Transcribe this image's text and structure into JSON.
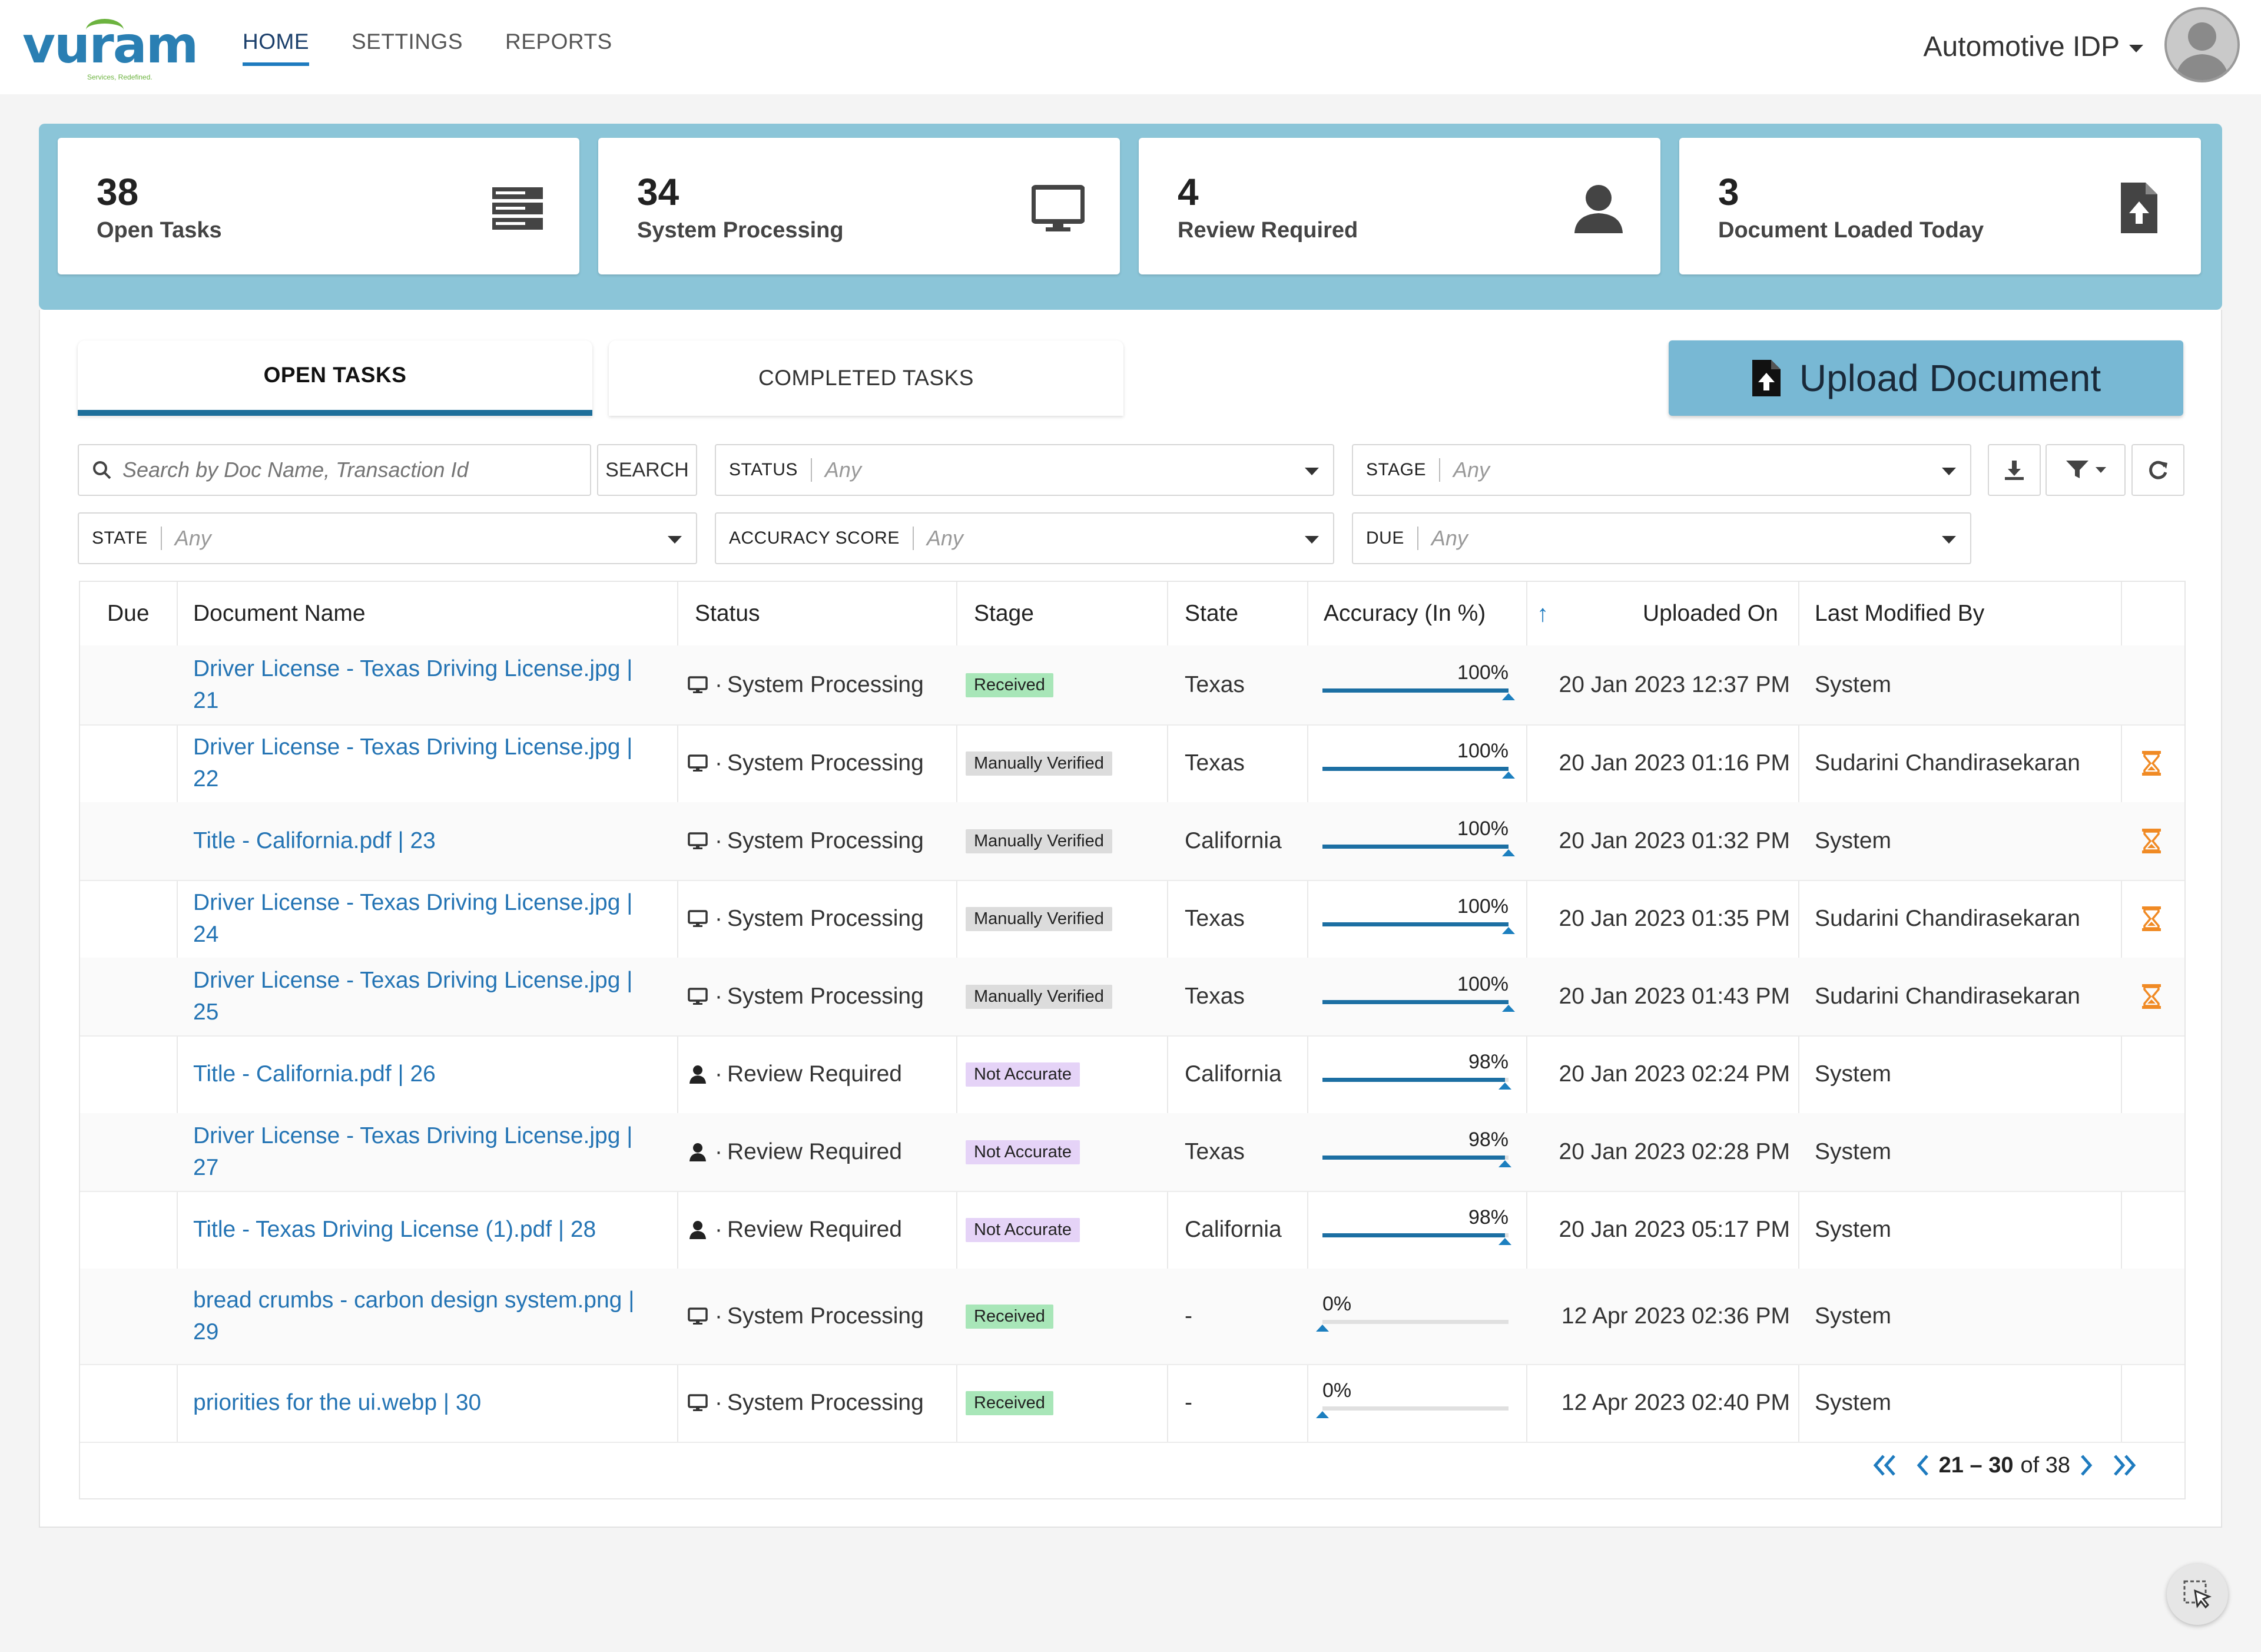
{
  "brand": {
    "logo_text": "vuram",
    "tagline": "Services, Redefined."
  },
  "nav": {
    "home": "HOME",
    "settings": "SETTINGS",
    "reports": "REPORTS"
  },
  "workspace": "Automotive IDP",
  "stats": [
    {
      "value": "38",
      "label": "Open Tasks",
      "icon": "server-icon"
    },
    {
      "value": "34",
      "label": "System Processing",
      "icon": "monitor-icon"
    },
    {
      "value": "4",
      "label": "Review Required",
      "icon": "user-icon"
    },
    {
      "value": "3",
      "label": "Document Loaded Today",
      "icon": "file-upload-icon"
    }
  ],
  "tabs": {
    "open": "OPEN TASKS",
    "completed": "COMPLETED TASKS"
  },
  "upload_label": "Upload Document",
  "search": {
    "placeholder": "Search by Doc Name, Transaction Id",
    "button": "SEARCH"
  },
  "filters": {
    "status": {
      "label": "STATUS",
      "value": "Any"
    },
    "stage": {
      "label": "STAGE",
      "value": "Any"
    },
    "state": {
      "label": "STATE",
      "value": "Any"
    },
    "accuracy": {
      "label": "ACCURACY SCORE",
      "value": "Any"
    },
    "due": {
      "label": "DUE",
      "value": "Any"
    }
  },
  "table": {
    "columns": {
      "due": "Due",
      "document_name": "Document Name",
      "status": "Status",
      "stage": "Stage",
      "state": "State",
      "accuracy": "Accuracy (In %)",
      "uploaded_on": "Uploaded On",
      "last_modified_by": "Last Modified By"
    },
    "rows": [
      {
        "document": "Driver License - Texas Driving License.jpg | 21",
        "status": "System Processing",
        "status_icon": "monitor-icon",
        "stage": "Received",
        "stage_color": "#a8e6b8",
        "state": "Texas",
        "accuracy": 100,
        "accuracy_label": "100%",
        "uploaded": "20 Jan 2023 12:37 PM",
        "modified_by": "System",
        "pending": false
      },
      {
        "document": "Driver License - Texas Driving License.jpg | 22",
        "status": "System Processing",
        "status_icon": "monitor-icon",
        "stage": "Manually Verified",
        "stage_color": "#dcdcdc",
        "state": "Texas",
        "accuracy": 100,
        "accuracy_label": "100%",
        "uploaded": "20 Jan 2023 01:16 PM",
        "modified_by": "Sudarini Chandirasekaran",
        "pending": true
      },
      {
        "document": "Title - California.pdf | 23",
        "status": "System Processing",
        "status_icon": "monitor-icon",
        "stage": "Manually Verified",
        "stage_color": "#dcdcdc",
        "state": "California",
        "accuracy": 100,
        "accuracy_label": "100%",
        "uploaded": "20 Jan 2023 01:32 PM",
        "modified_by": "System",
        "pending": true
      },
      {
        "document": "Driver License - Texas Driving License.jpg | 24",
        "status": "System Processing",
        "status_icon": "monitor-icon",
        "stage": "Manually Verified",
        "stage_color": "#dcdcdc",
        "state": "Texas",
        "accuracy": 100,
        "accuracy_label": "100%",
        "uploaded": "20 Jan 2023 01:35 PM",
        "modified_by": "Sudarini Chandirasekaran",
        "pending": true
      },
      {
        "document": "Driver License - Texas Driving License.jpg | 25",
        "status": "System Processing",
        "status_icon": "monitor-icon",
        "stage": "Manually Verified",
        "stage_color": "#dcdcdc",
        "state": "Texas",
        "accuracy": 100,
        "accuracy_label": "100%",
        "uploaded": "20 Jan 2023 01:43 PM",
        "modified_by": "Sudarini Chandirasekaran",
        "pending": true
      },
      {
        "document": "Title - California.pdf | 26",
        "status": "Review Required",
        "status_icon": "user-icon",
        "stage": "Not Accurate",
        "stage_color": "#e5d3f7",
        "state": "California",
        "accuracy": 98,
        "accuracy_label": "98%",
        "uploaded": "20 Jan 2023 02:24 PM",
        "modified_by": "System",
        "pending": false
      },
      {
        "document": "Driver License - Texas Driving License.jpg | 27",
        "status": "Review Required",
        "status_icon": "user-icon",
        "stage": "Not Accurate",
        "stage_color": "#e5d3f7",
        "state": "Texas",
        "accuracy": 98,
        "accuracy_label": "98%",
        "uploaded": "20 Jan 2023 02:28 PM",
        "modified_by": "System",
        "pending": false
      },
      {
        "document": "Title - Texas Driving License (1).pdf | 28",
        "status": "Review Required",
        "status_icon": "user-icon",
        "stage": "Not Accurate",
        "stage_color": "#e5d3f7",
        "state": "California",
        "accuracy": 98,
        "accuracy_label": "98%",
        "uploaded": "20 Jan 2023 05:17 PM",
        "modified_by": "System",
        "pending": false
      },
      {
        "document": "bread crumbs - carbon design system.png | 29",
        "status": "System Processing",
        "status_icon": "monitor-icon",
        "stage": "Received",
        "stage_color": "#a8e6b8",
        "state": "-",
        "accuracy": 0,
        "accuracy_label": "0%",
        "uploaded": "12 Apr 2023 02:36 PM",
        "modified_by": "System",
        "pending": false
      },
      {
        "document": "priorities for the ui.webp | 30",
        "status": "System Processing",
        "status_icon": "monitor-icon",
        "stage": "Received",
        "stage_color": "#a8e6b8",
        "state": "-",
        "accuracy": 0,
        "accuracy_label": "0%",
        "uploaded": "12 Apr 2023 02:40 PM",
        "modified_by": "System",
        "pending": false
      }
    ]
  },
  "pagination": {
    "range": "21 – 30",
    "of_label": "of 38"
  },
  "colors": {
    "accent": "#1e7bbf",
    "band": "#8bc5d8",
    "upload": "#78b8d4",
    "link": "#2474b4",
    "pending": "#f08a24"
  }
}
